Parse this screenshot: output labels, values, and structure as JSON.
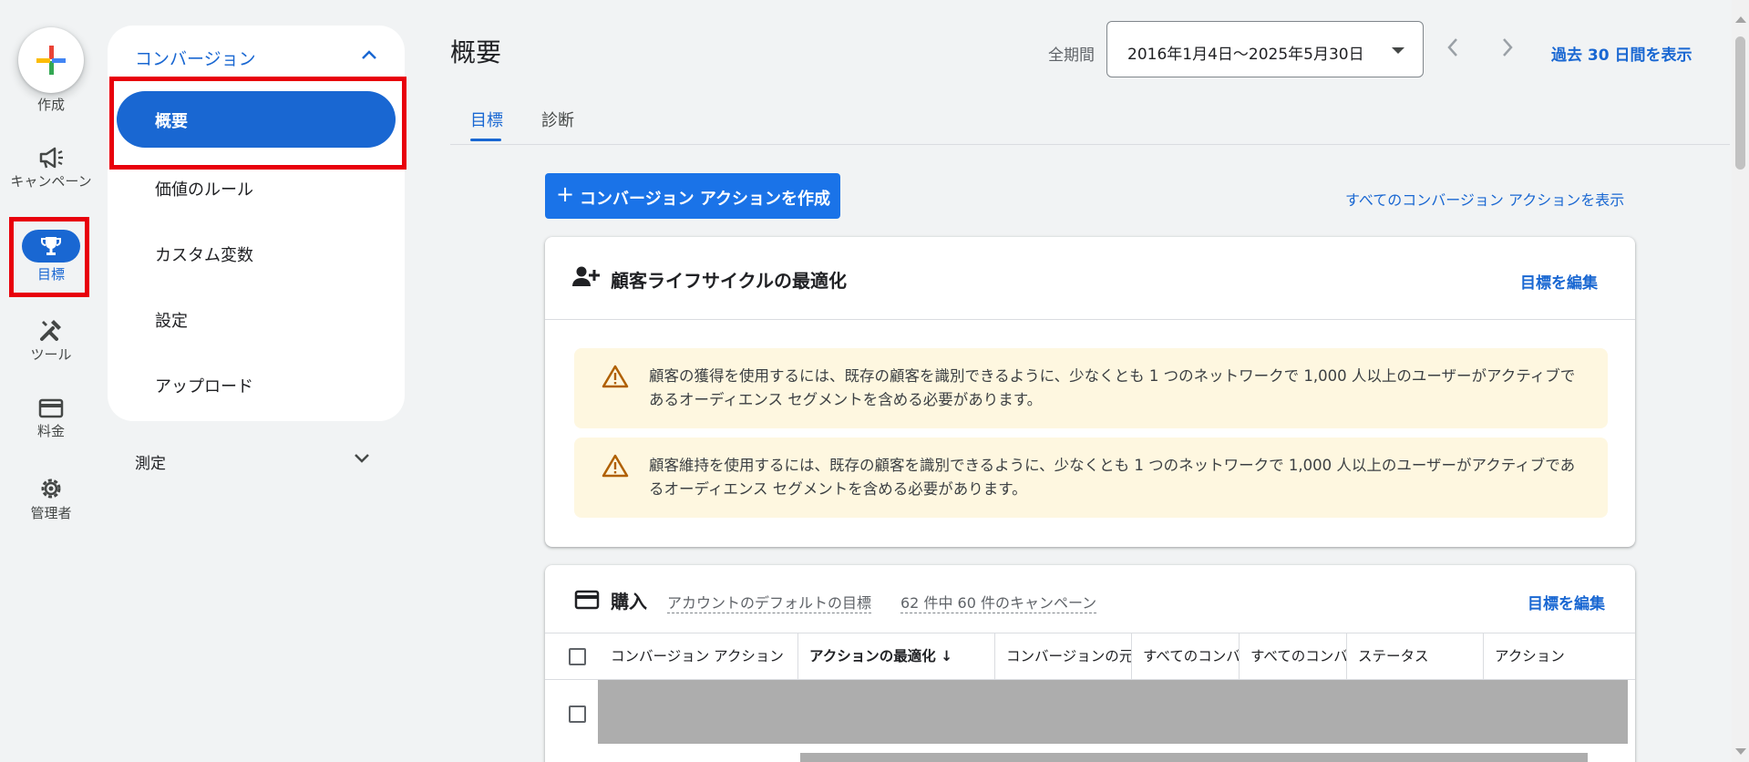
{
  "rail": {
    "create_label": "作成",
    "items": [
      {
        "label": "キャンペーン",
        "icon": "megaphone-icon"
      },
      {
        "label": "目標",
        "icon": "trophy-icon"
      },
      {
        "label": "ツール",
        "icon": "tools-icon"
      },
      {
        "label": "料金",
        "icon": "credit-card-icon"
      },
      {
        "label": "管理者",
        "icon": "gear-icon"
      }
    ]
  },
  "subnav": {
    "section_title": "コンバージョン",
    "items": [
      "概要",
      "価値のルール",
      "カスタム変数",
      "設定",
      "アップロード"
    ],
    "measure_label": "測定"
  },
  "header": {
    "title": "概要",
    "period_label": "全期間",
    "date_range": "2016年1月4日〜2025年5月30日",
    "show_30_days": "過去 30 日間を表示"
  },
  "tabs": [
    "目標",
    "診断"
  ],
  "actions": {
    "create_button": "コンバージョン アクションを作成",
    "view_all": "すべてのコンバージョン アクションを表示"
  },
  "lifecycle_card": {
    "title": "顧客ライフサイクルの最適化",
    "edit_link": "目標を編集",
    "warnings": [
      "顧客の獲得を使用するには、既存の顧客を識別できるように、少なくとも 1 つのネットワークで 1,000 人以上のユーザーがアクティブであるオーディエンス セグメントを含める必要があります。",
      "顧客維持を使用するには、既存の顧客を識別できるように、少なくとも 1 つのネットワークで 1,000 人以上のユーザーがアクティブであるオーディエンス セグメントを含める必要があります。"
    ]
  },
  "purchase_card": {
    "title": "購入",
    "default_goal": "アカウントのデフォルトの目標",
    "campaign_count": "62 件中 60 件のキャンペーン",
    "edit_link": "目標を編集",
    "columns": [
      "コンバージョン アクション",
      "アクションの最適化 ↓",
      "コンバージョンの元",
      "すべてのコンバ",
      "すべてのコンバ",
      "ステータス",
      "アクション"
    ]
  },
  "colors": {
    "accent": "#1967d2",
    "button": "#1a73e8",
    "warning_bg": "#fef7e0",
    "warning_icon": "#b06000",
    "highlight_box": "#e8000b"
  }
}
